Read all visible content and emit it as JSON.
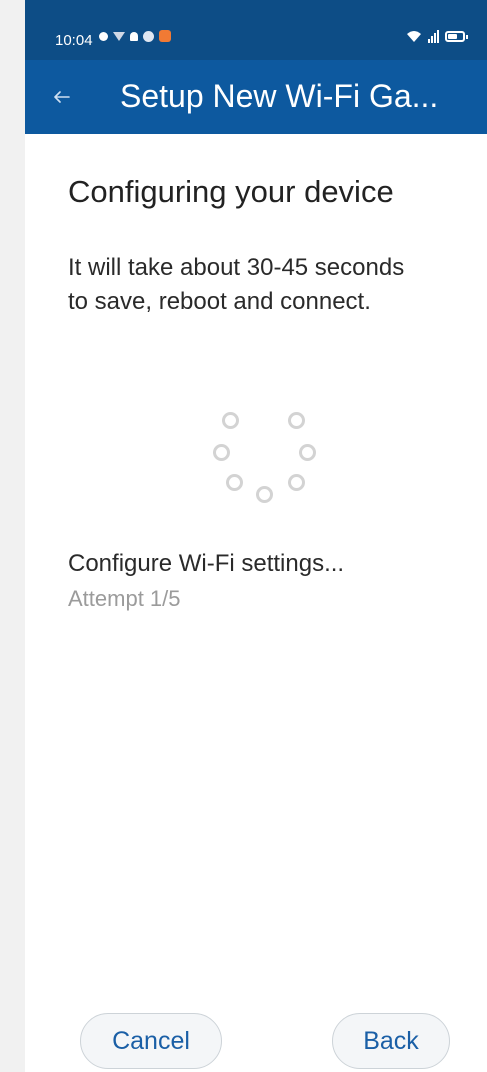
{
  "status_bar": {
    "time": "10:04",
    "left_icons": [
      "message-icon",
      "wifi-icon",
      "notification-icon",
      "shield-icon",
      "app-icon"
    ],
    "right_icons": [
      "wifi-icon",
      "signal-icon",
      "battery-icon"
    ]
  },
  "app_bar": {
    "back_icon": "arrow-left-icon",
    "title": "Setup New Wi-Fi Ga..."
  },
  "main": {
    "heading": "Configuring your device",
    "description": "It will take about 30-45 seconds to save, reboot and connect.",
    "step": "Configure Wi-Fi settings...",
    "attempt": "Attempt 1/5"
  },
  "actions": {
    "cancel_label": "Cancel",
    "back_label": "Back"
  },
  "colors": {
    "status_bar": "#0d4d86",
    "app_bar": "#0d599f",
    "button_text": "#1a5fa6",
    "spinner_dot": "#d3d3d3"
  }
}
